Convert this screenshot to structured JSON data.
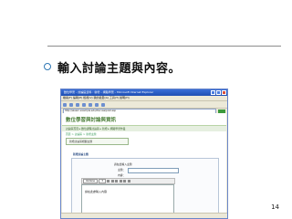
{
  "slide": {
    "heading": "輸入討論主題與內容。",
    "page_number": "14"
  },
  "browser": {
    "title": "數位學習 – 討論區資料 : 新增 – 網路學習 – Microsoft Internet Explorer",
    "menu": "檔案(F)  編輯(E)  檢視(V)  我的最愛(A)  工具(T)  說明(H)",
    "address": "http://elearn.example.edu/discuss/post.asp"
  },
  "page": {
    "site_title": "數位學習與討論與資訊",
    "nav": "討論區首頁 ▸ 數位課程討論區 ▸ 新增 ▸ 網路學習作業",
    "breadcrumb": "首頁 > 討論區 > 新增主題",
    "crumb_box": "新增討論區相關主題",
    "section_label": "新增討論主題",
    "subject_label": "主題：",
    "subject_hint": "請在此輸入主題",
    "content_label": "內容：",
    "font_select": "Verdana",
    "size_select": "3",
    "editor_text": "請在此處輸入內容"
  },
  "icons": {
    "bullet": "circle-bullet-icon",
    "close": "close-icon",
    "back": "back-arrow-icon",
    "go": "go-arrow-icon"
  },
  "colors": {
    "bullet": "#2f77b4",
    "titlebar": "#1f4fb3",
    "site_title": "#4d7f3a"
  }
}
